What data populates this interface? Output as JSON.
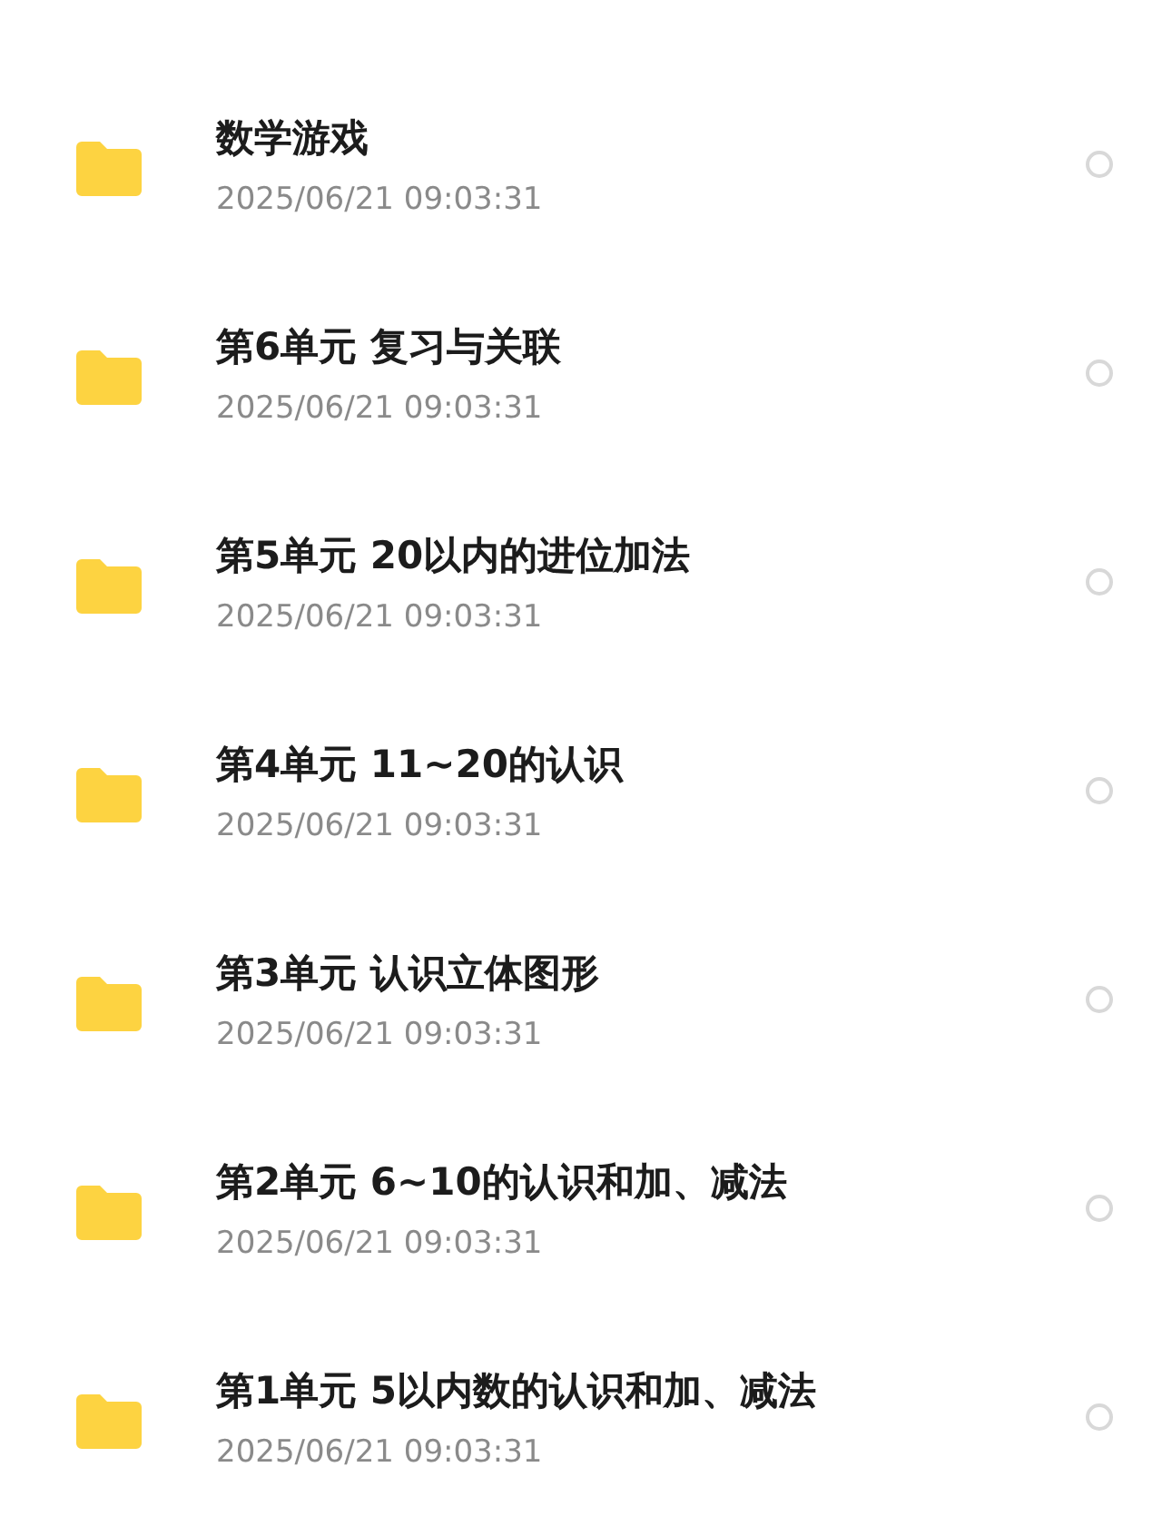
{
  "files": [
    {
      "name": "数学游戏",
      "date": "2025/06/21 09:03:31",
      "selected": false
    },
    {
      "name": "第6单元 复习与关联",
      "date": "2025/06/21 09:03:31",
      "selected": false
    },
    {
      "name": "第5单元 20以内的进位加法",
      "date": "2025/06/21 09:03:31",
      "selected": false
    },
    {
      "name": "第4单元 11~20的认识",
      "date": "2025/06/21 09:03:31",
      "selected": false
    },
    {
      "name": "第3单元 认识立体图形",
      "date": "2025/06/21 09:03:31",
      "selected": false
    },
    {
      "name": "第2单元 6~10的认识和加、减法",
      "date": "2025/06/21 09:03:31",
      "selected": false
    },
    {
      "name": "第1单元 5以内数的认识和加、减法",
      "date": "2025/06/21 09:03:31",
      "selected": false
    }
  ]
}
